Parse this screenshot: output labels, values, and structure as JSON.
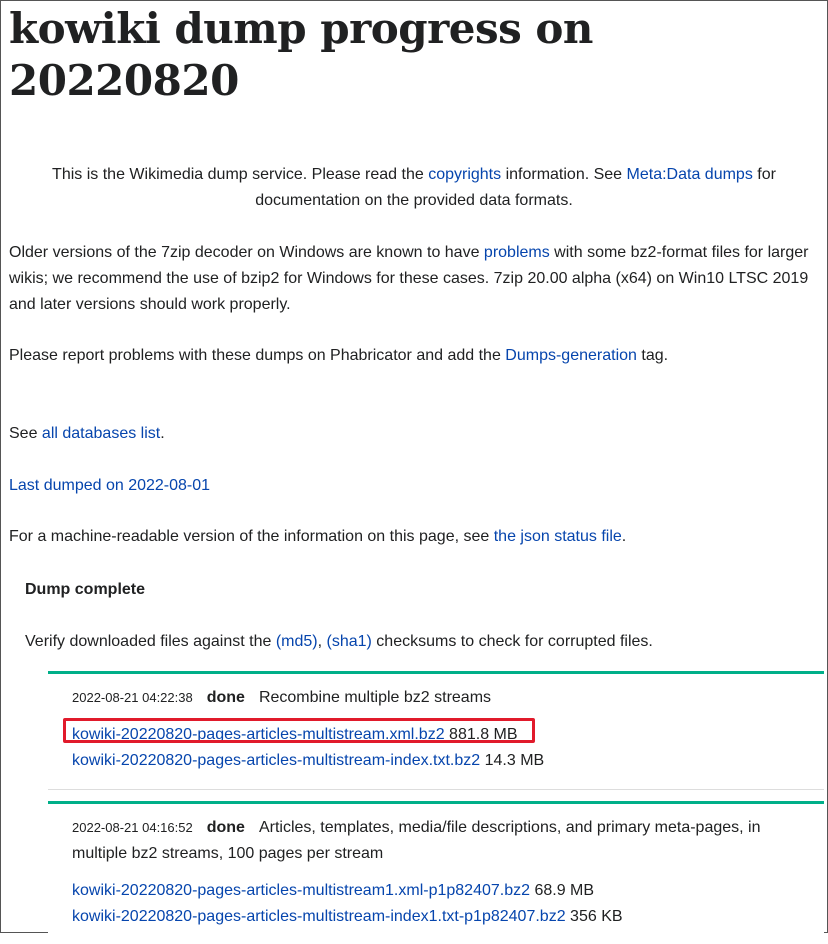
{
  "title": "kowiki dump progress on 20220820",
  "intro": {
    "t1": "This is the Wikimedia dump service. Please read the ",
    "copyrights_link": "copyrights",
    "t2": " information. See ",
    "meta_link": "Meta:Data dumps",
    "t3": " for documentation on the provided data formats."
  },
  "older": {
    "t1": "Older versions of the 7zip decoder on Windows are known to have ",
    "problems_link": "problems",
    "t2": " with some bz2-format files for larger wikis; we recommend the use of bzip2 for Windows for these cases. 7zip 20.00 alpha (x64) on Win10 LTSC 2019 and later versions should work properly."
  },
  "report": {
    "t1": "Please report problems with these dumps on Phabricator and add the ",
    "tag_link": "Dumps-generation",
    "t2": " tag."
  },
  "see": {
    "t1": "See ",
    "all_link": "all databases list",
    "t2": "."
  },
  "last_dumped_link": "Last dumped on 2022-08-01",
  "machine": {
    "t1": "For a machine-readable version of the information on this page, see ",
    "json_link": "the json status file",
    "t2": "."
  },
  "dump_status": "Dump complete",
  "verify": {
    "t1": "Verify downloaded files against the ",
    "md5_link": "(md5)",
    "t2": ", ",
    "sha1_link": "(sha1)",
    "t3": " checksums to check for corrupted files."
  },
  "jobs": [
    {
      "timestamp": "2022-08-21 04:22:38",
      "status": "done",
      "description": "Recombine multiple bz2 streams",
      "files": [
        {
          "name": "kowiki-20220820-pages-articles-multistream.xml.bz2",
          "size": "881.8 MB"
        },
        {
          "name": "kowiki-20220820-pages-articles-multistream-index.txt.bz2",
          "size": "14.3 MB"
        }
      ]
    },
    {
      "timestamp": "2022-08-21 04:16:52",
      "status": "done",
      "description": "Articles, templates, media/file descriptions, and primary meta-pages, in multiple bz2 streams, 100 pages per stream",
      "files": [
        {
          "name": "kowiki-20220820-pages-articles-multistream1.xml-p1p82407.bz2",
          "size": "68.9 MB"
        },
        {
          "name": "kowiki-20220820-pages-articles-multistream-index1.txt-p1p82407.bz2",
          "size": "356 KB"
        }
      ]
    }
  ],
  "colors": {
    "link": "#0645ad",
    "job_border": "#00af89",
    "highlight": "#e11a2b"
  }
}
